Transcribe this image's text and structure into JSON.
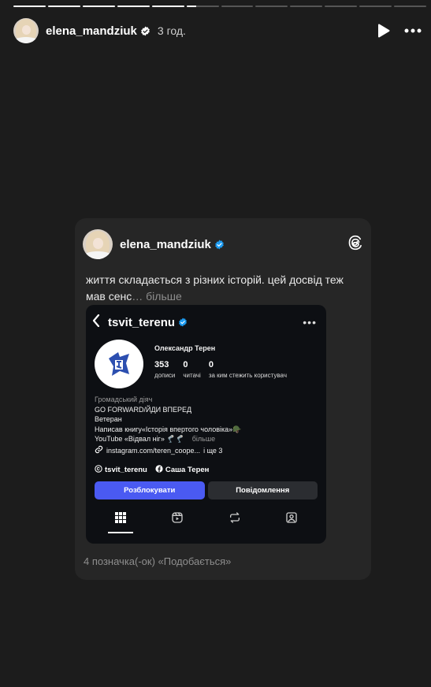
{
  "story": {
    "segments_total": 12,
    "segments_complete": 5,
    "current_segment_progress": 0.3,
    "username": "elena_mandziuk",
    "time": "3 год."
  },
  "post": {
    "username": "elena_mandziuk",
    "caption": "життя складається з різних історій. цей досвід теж мав сенс",
    "more": "… більше",
    "likes": "4 позначка(-ок) «Подобається»"
  },
  "profile": {
    "username": "tsvit_terenu",
    "name": "Олександр Терен",
    "stats": [
      {
        "value": "353",
        "label": "дописи"
      },
      {
        "value": "0",
        "label": "читачі"
      },
      {
        "value": "0",
        "label": "за ким стежить користувач"
      }
    ],
    "bio": {
      "category": "Громадський діяч",
      "line1": "GO FORWARD/ЙДИ ВПЕРЕД",
      "line2": "Ветеран",
      "line3": "Написав книгу«Історія впертого чоловіка»🪖",
      "line4": "YouTube «Відвал ніг» 🦿🦿",
      "line4_more": "більше",
      "link": "instagram.com/teren_coope...",
      "link_more": "і ще 3"
    },
    "threads_handle": "tsvit_terenu",
    "facebook_name": "Саша Терен",
    "unblock_label": "Розблокувати",
    "message_label": "Повідомлення"
  },
  "colors": {
    "background": "#1c1c1c",
    "card": "#262626",
    "accent_button": "#4a5af2",
    "verified": "#1d9bf0"
  }
}
